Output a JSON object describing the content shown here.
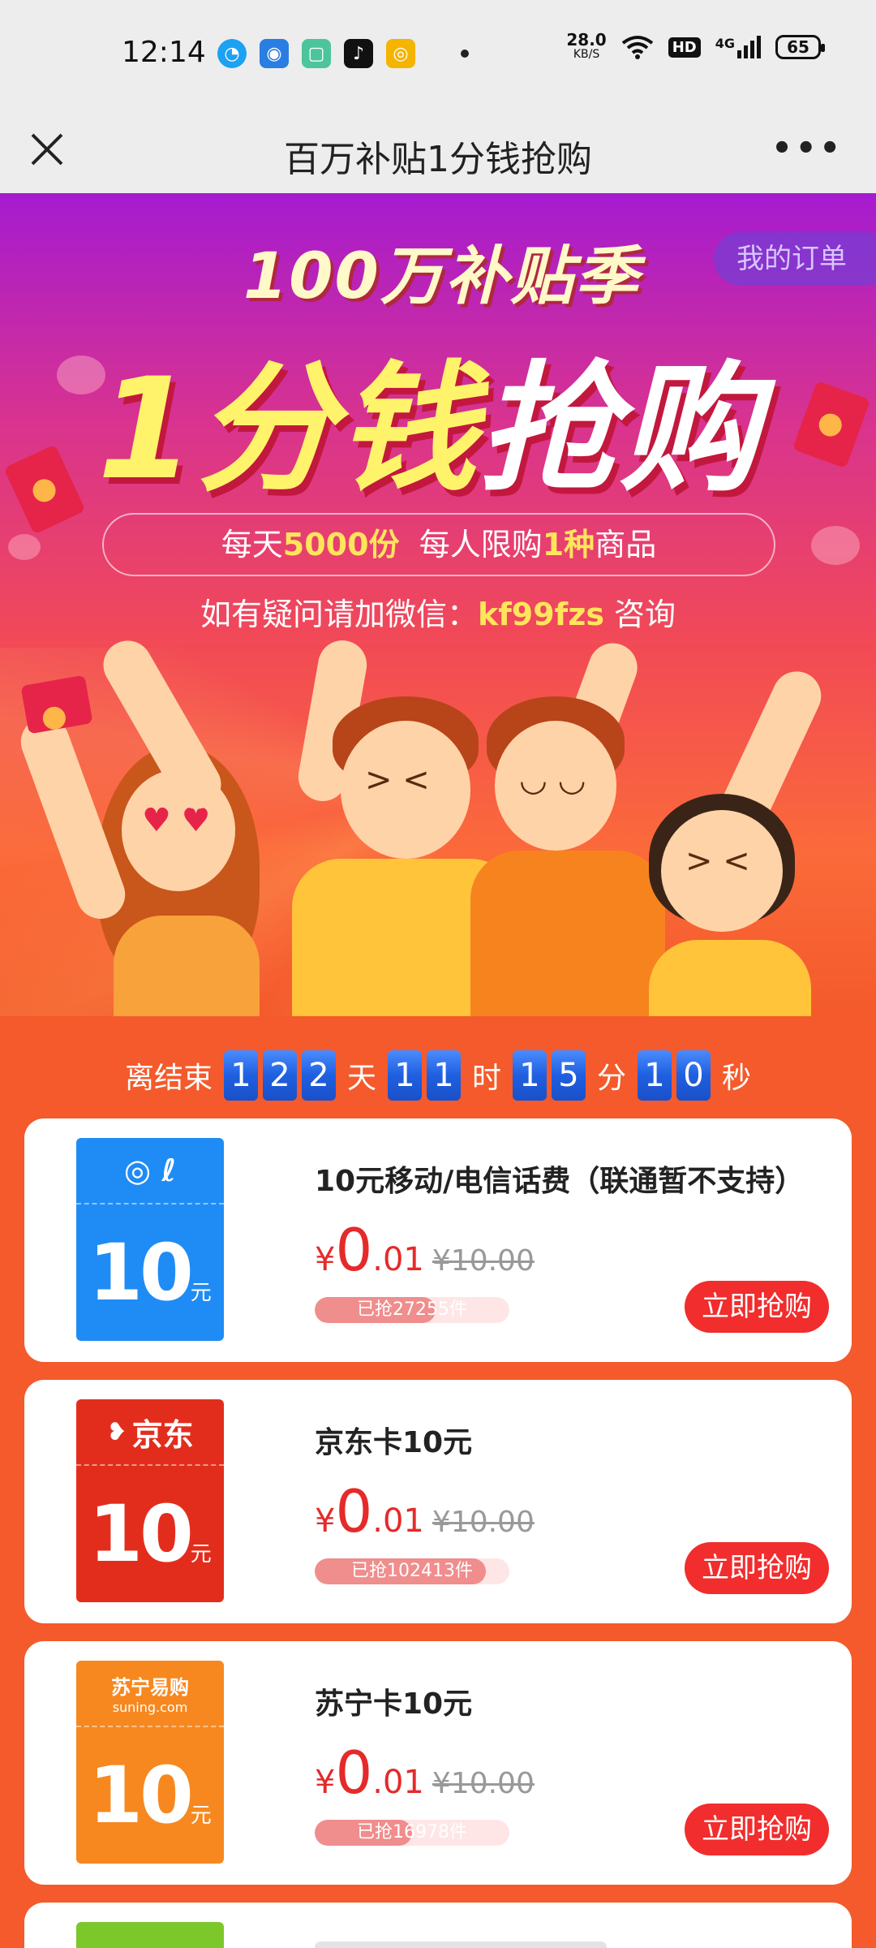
{
  "status_bar": {
    "time": "12:14",
    "net_speed_value": "28.0",
    "net_speed_unit": "KB/S",
    "hd": "HD",
    "network": "4G",
    "battery": "65"
  },
  "header": {
    "title": "百万补贴1分钱抢购"
  },
  "hero": {
    "season_title": "100万补贴季",
    "my_orders_label": "我的订单",
    "main_title_yellow": "1分钱",
    "main_title_white": "抢购",
    "quota_parts": [
      "每天",
      "5000份",
      "  每人限购",
      "1种",
      "商品"
    ],
    "wechat_prefix": "如有疑问请加微信：",
    "wechat_id": "kf99fzs",
    "wechat_suffix": " 咨询"
  },
  "countdown": {
    "prefix": "离结束",
    "days_digits": [
      "1",
      "2",
      "2"
    ],
    "days_label": "天",
    "hours_digits": [
      "1",
      "1"
    ],
    "hours_label": "时",
    "minutes_digits": [
      "1",
      "5"
    ],
    "minutes_label": "分",
    "seconds_digits": [
      "1",
      "0"
    ],
    "seconds_label": "秒"
  },
  "products": [
    {
      "name": "10元移动/电信话费（联通暂不支持）",
      "thumb_brand": "◎ ℓ",
      "thumb_value": "10",
      "thumb_unit": "元",
      "thumb_color": "#1f8cf5",
      "price_symbol": "¥",
      "price_int": "0",
      "price_dec": ".01",
      "original_price": "¥10.00",
      "sold_text": "已抢27255件",
      "sold_fraction": 0.62,
      "button": "立即抢购"
    },
    {
      "name": "京东卡10元",
      "thumb_brand": "京东",
      "thumb_value": "10",
      "thumb_unit": "元",
      "thumb_color": "#e32d1c",
      "price_symbol": "¥",
      "price_int": "0",
      "price_dec": ".01",
      "original_price": "¥10.00",
      "sold_text": "已抢102413件",
      "sold_fraction": 0.88,
      "button": "立即抢购"
    },
    {
      "name": "苏宁卡10元",
      "thumb_brand": "苏宁易购",
      "thumb_sub": "suning.com",
      "thumb_value": "10",
      "thumb_unit": "元",
      "thumb_color": "#f7881f",
      "price_symbol": "¥",
      "price_int": "0",
      "price_dec": ".01",
      "original_price": "¥10.00",
      "sold_text": "已抢16978件",
      "sold_fraction": 0.5,
      "button": "立即抢购"
    }
  ],
  "colors": {
    "accent_red": "#f12d2d",
    "page_bg": "#f45a2b",
    "countdown_blue": "#1f5fe0"
  }
}
